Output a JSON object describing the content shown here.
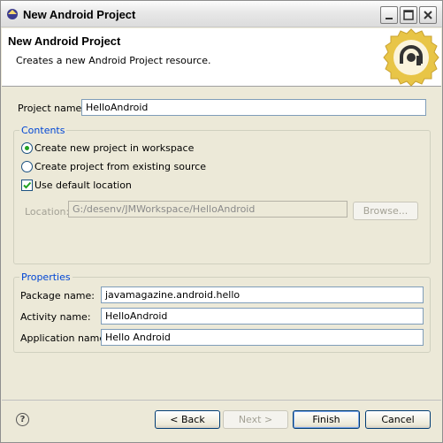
{
  "window": {
    "title": "New Android Project"
  },
  "banner": {
    "title": "New Android Project",
    "description": "Creates a new Android Project resource."
  },
  "project": {
    "name_label": "Project name:",
    "name_value": "HelloAndroid"
  },
  "contents": {
    "group_label": "Contents",
    "options": [
      {
        "label": "Create new project in workspace",
        "selected": true
      },
      {
        "label": "Create project from existing source",
        "selected": false
      }
    ],
    "use_default_label": "Use default location",
    "use_default_checked": true,
    "location_label": "Location:",
    "location_value": "G:/desenv/JMWorkspace/HelloAndroid",
    "browse_label": "Browse..."
  },
  "properties": {
    "group_label": "Properties",
    "package_label": "Package name:",
    "package_value": "javamagazine.android.hello",
    "activity_label": "Activity name:",
    "activity_value": "HelloAndroid",
    "application_label": "Application name:",
    "application_value": "Hello Android"
  },
  "footer": {
    "help_glyph": "?",
    "back_label": "< Back",
    "next_label": "Next >",
    "finish_label": "Finish",
    "cancel_label": "Cancel"
  },
  "colors": {
    "group_label": "#0046d5",
    "seal_gold": "#e8c547"
  },
  "icons": {
    "title": "android-app-icon",
    "seal": "android-logo-seal"
  }
}
